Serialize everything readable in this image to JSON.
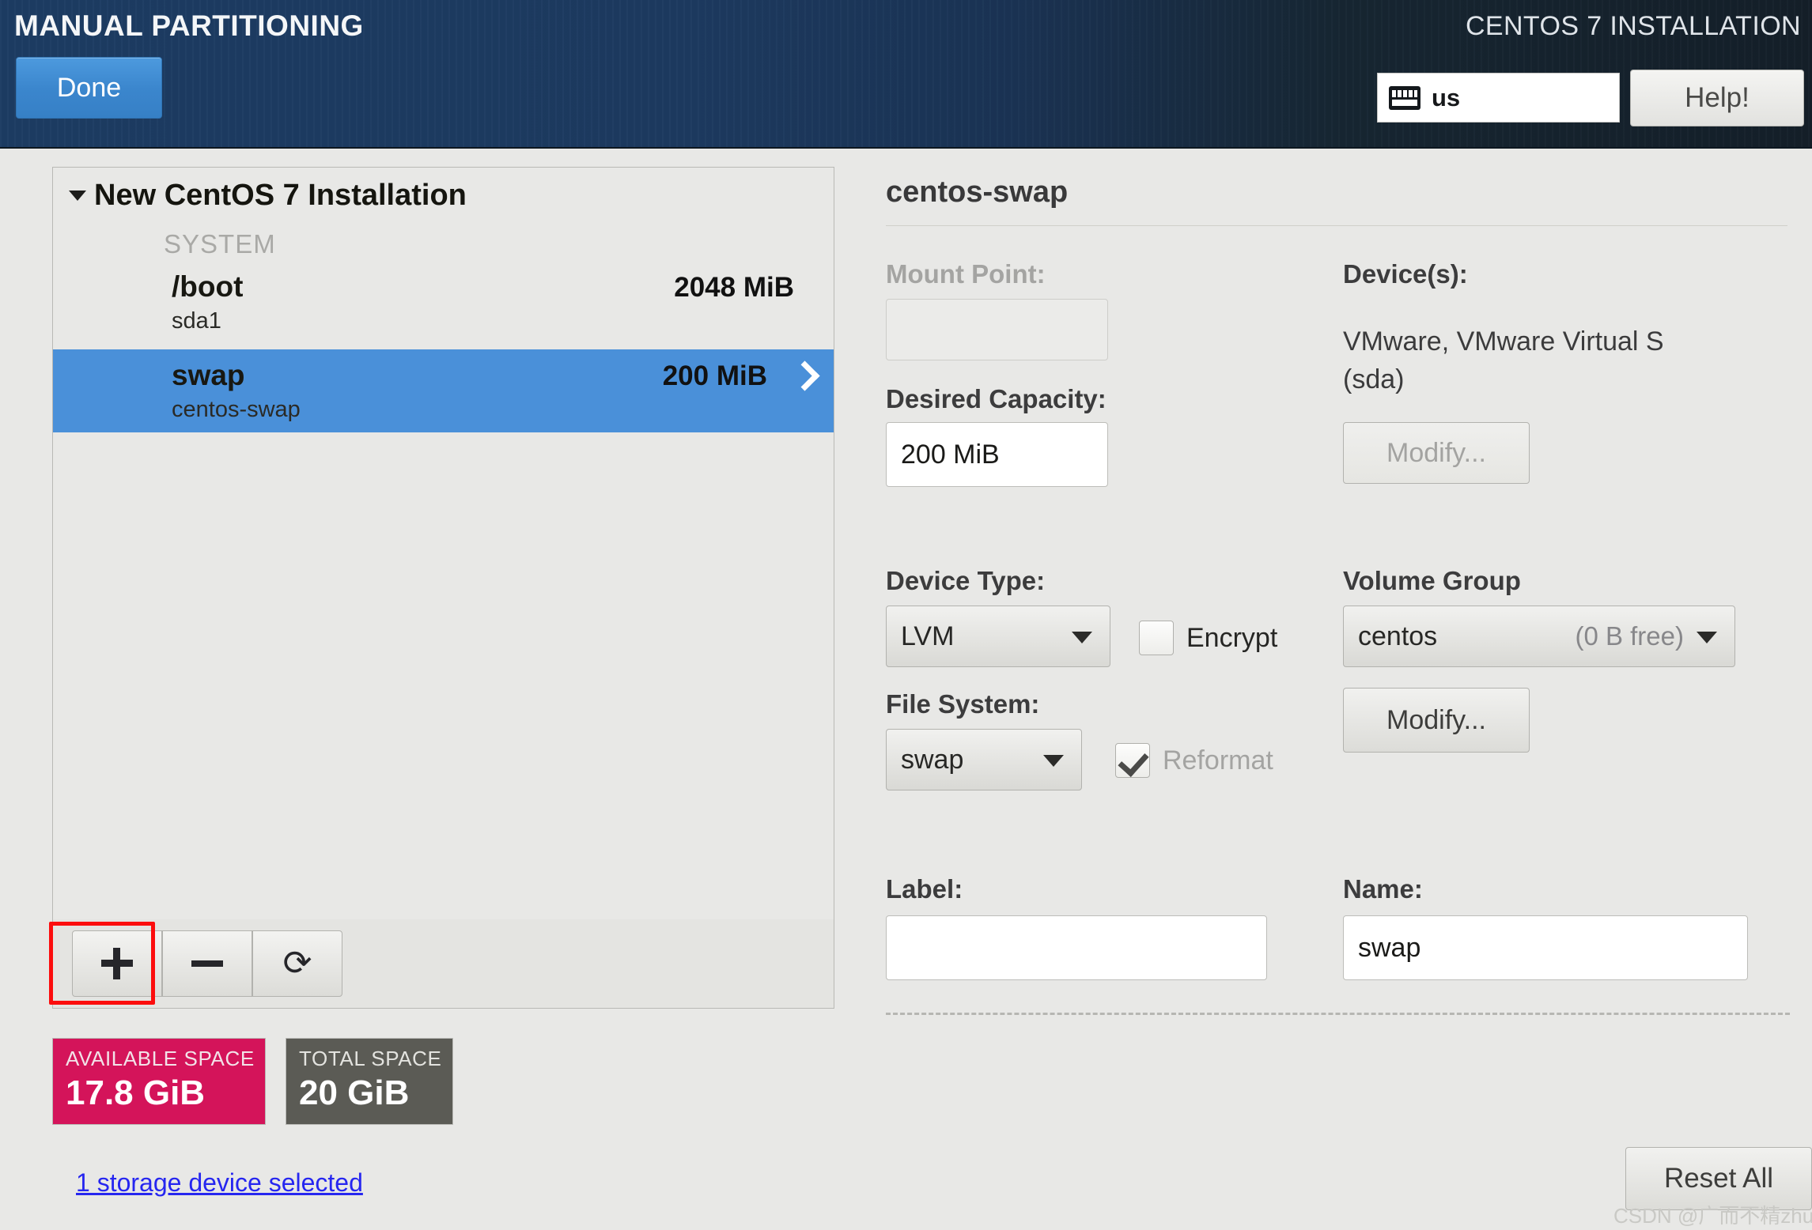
{
  "header": {
    "screen_title": "MANUAL PARTITIONING",
    "product_title": "CENTOS 7 INSTALLATION",
    "done_label": "Done",
    "keyboard_layout": "us",
    "keyboard_icon": "keyboard-icon",
    "help_label": "Help!"
  },
  "partitions": {
    "root_label": "New CentOS 7 Installation",
    "group_label": "SYSTEM",
    "rows": [
      {
        "mount": "/boot",
        "device": "sda1",
        "size": "2048 MiB",
        "selected": false
      },
      {
        "mount": "swap",
        "device": "centos-swap",
        "size": "200 MiB",
        "selected": true
      }
    ],
    "toolbar": {
      "add_label": "+",
      "remove_label": "−",
      "reload_label": "⟳"
    }
  },
  "space": {
    "available_caption": "AVAILABLE SPACE",
    "available_value": "17.8 GiB",
    "available_color": "#d4145a",
    "total_caption": "TOTAL SPACE",
    "total_value": "20 GiB",
    "total_color": "#5b5b55",
    "device_link": "1 storage device selected"
  },
  "details": {
    "title": "centos-swap",
    "mount_point_label": "Mount Point:",
    "mount_point_value": "",
    "desired_capacity_label": "Desired Capacity:",
    "desired_capacity_value": "200 MiB",
    "devices_label": "Device(s):",
    "devices_value": "VMware, VMware Virtual S (sda)",
    "devices_modify_label": "Modify...",
    "device_type_label": "Device Type:",
    "device_type_value": "LVM",
    "encrypt_label": "Encrypt",
    "encrypt_checked": false,
    "file_system_label": "File System:",
    "file_system_value": "swap",
    "reformat_label": "Reformat",
    "reformat_checked": true,
    "volume_group_label": "Volume Group",
    "volume_group_value": "centos",
    "volume_group_free": "(0 B free)",
    "volume_group_modify_label": "Modify...",
    "label_label": "Label:",
    "label_value": "",
    "name_label": "Name:",
    "name_value": "swap"
  },
  "footer": {
    "reset_all_label": "Reset All",
    "watermark": "CSDN @广而不精zhu小白"
  },
  "colors": {
    "selection_blue": "#4a90d9",
    "done_blue": "#3b86cd",
    "annotation_red": "#fc0d0d",
    "link_blue": "#2626f0"
  }
}
